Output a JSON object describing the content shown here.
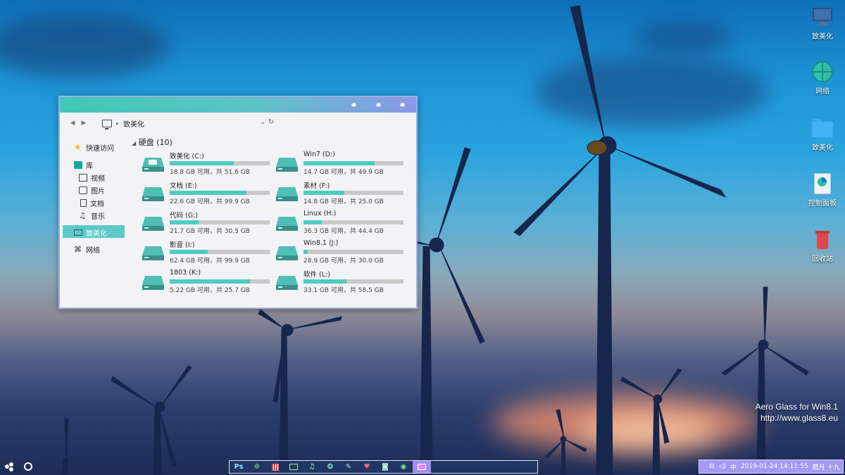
{
  "explorer": {
    "address": "致美化",
    "sidebar": {
      "quick_access": "快速访问",
      "library": "库",
      "videos": "视频",
      "pictures": "图片",
      "documents": "文档",
      "music": "音乐",
      "this_pc": "致美化",
      "network": "网络"
    },
    "section_title": "硬盘 (10)",
    "drives": [
      {
        "name": "致美化 (C:)",
        "info": "18.8 GB 可用，共 51.6 GB",
        "used_percent": 64
      },
      {
        "name": "Win7 (D:)",
        "info": "14.7 GB 可用，共 49.9 GB",
        "used_percent": 71
      },
      {
        "name": "文档 (E:)",
        "info": "22.6 GB 可用，共 99.9 GB",
        "used_percent": 77
      },
      {
        "name": "素材 (F:)",
        "info": "14.8 GB 可用，共 25.0 GB",
        "used_percent": 41
      },
      {
        "name": "代码 (G:)",
        "info": "21.7 GB 可用，共 30.5 GB",
        "used_percent": 29
      },
      {
        "name": "Linux (H:)",
        "info": "36.3 GB 可用，共 44.4 GB",
        "used_percent": 18
      },
      {
        "name": "影音 (I:)",
        "info": "62.4 GB 可用，共 99.9 GB",
        "used_percent": 38
      },
      {
        "name": "Win8.1 (J:)",
        "info": "28.9 GB 可用，共 30.0 GB",
        "used_percent": 4
      },
      {
        "name": "1803 (K:)",
        "info": "5.22 GB 可用，共 25.7 GB",
        "used_percent": 80
      },
      {
        "name": "软件 (L:)",
        "info": "33.1 GB 可用，共 58.5 GB",
        "used_percent": 43
      }
    ]
  },
  "desktop_icons": [
    {
      "label": "致美化",
      "icon": "monitor-icon"
    },
    {
      "label": "网络",
      "icon": "globe-icon"
    },
    {
      "label": "致美化",
      "icon": "folder-icon"
    },
    {
      "label": "控制面板",
      "icon": "control-panel-icon"
    },
    {
      "label": "回收站",
      "icon": "recycle-bin-icon"
    }
  ],
  "watermark": {
    "line1": "Aero Glass for Win8.1",
    "line2": "http://www.glass8.eu"
  },
  "taskbar": {
    "dock_ps": "Ps",
    "tray_ime": "中",
    "tray_datetime": "2019-01-24  14:11:55",
    "tray_lunar": "腊月 十九"
  },
  "colors": {
    "accent": "#4fcbc1",
    "tray": "#a49af2",
    "title_start": "#3fc8b5",
    "title_end": "#8a97e8"
  }
}
